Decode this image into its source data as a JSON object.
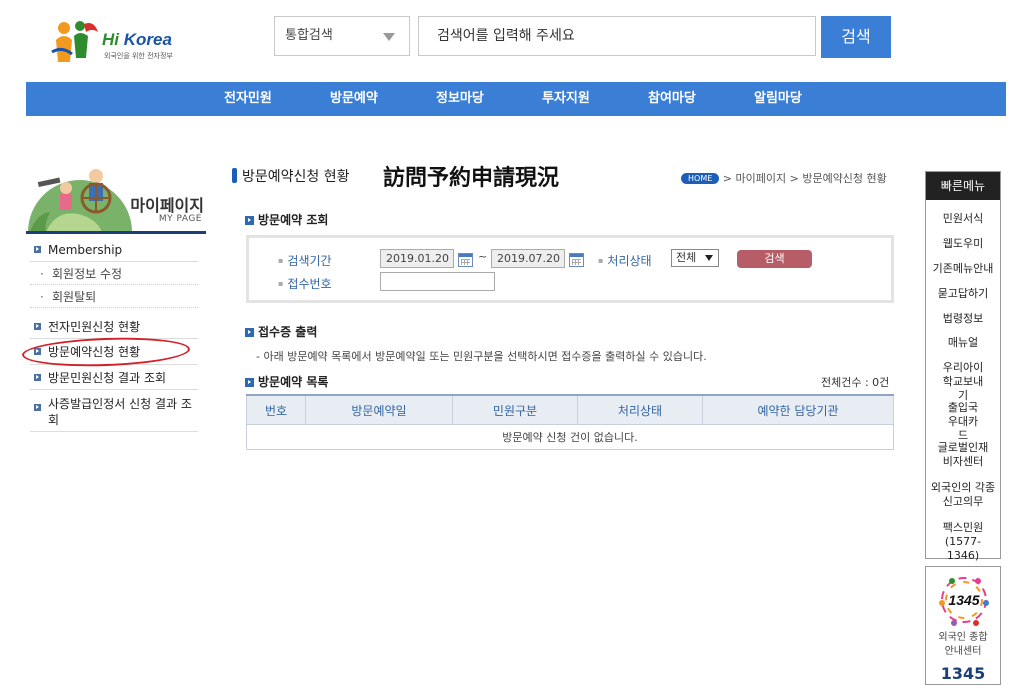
{
  "header": {
    "logo": {
      "brand_prefix": "Hi",
      "brand_name": "Korea",
      "tagline": "외국인을 위한 전자정부"
    },
    "search": {
      "scope": "통합검색",
      "placeholder": "검색어를 입력해 주세요",
      "button": "검색"
    },
    "gnb": [
      "전자민원",
      "방문예약",
      "정보마당",
      "투자지원",
      "참여마당",
      "알림마당"
    ]
  },
  "sidebar": {
    "banner_title": "마이페이지",
    "banner_subtitle": "MY PAGE",
    "items": [
      {
        "label": "Membership",
        "children": [
          "회원정보 수정",
          "회원탈퇴"
        ]
      },
      {
        "label": "전자민원신청 현황"
      },
      {
        "label": "방문예약신청 현황"
      },
      {
        "label": "방문민원신청 결과 조회"
      },
      {
        "label": "사증발급인정서 신청 결과 조회"
      }
    ]
  },
  "main": {
    "title": "방문예약신청 현황",
    "title_hanja": "訪問予約申請現況",
    "breadcrumb": {
      "home": "HOME",
      "sep": ">",
      "items": [
        "마이페이지",
        "방문예약신청 현황"
      ]
    },
    "search_section": {
      "title": "방문예약 조회",
      "period_label": "검색기간",
      "date_from": "2019.01.20",
      "date_sep": "~",
      "date_to": "2019.07.20",
      "status_label": "처리상태",
      "status_value": "전체",
      "search_button": "검색",
      "receipt_label": "접수번호"
    },
    "receipt_section": {
      "title": "접수증 출력",
      "description": "- 아래 방문예약 목록에서 방문예약일 또는 민원구분을 선택하시면 접수증을 출력하실 수 있습니다."
    },
    "list_section": {
      "title": "방문예약 목록",
      "total": "전체건수 : 0건",
      "columns": [
        "번호",
        "방문예약일",
        "민원구분",
        "처리상태",
        "예약한 담당기관"
      ],
      "empty_message": "방문예약 신청 건이 없습니다."
    }
  },
  "quick_menu": {
    "title": "빠른메뉴",
    "items": [
      "민원서식",
      "웹도우미",
      "기존메뉴안내",
      "묻고답하기",
      "법령정보",
      "매뉴얼",
      "우리아이 학교보내기",
      "출입국 우대카드",
      "글로벌인재 비자센터",
      "외국인의 각종 신고의무",
      "팩스민원 (1577-1346)"
    ]
  },
  "help_center": {
    "badge": "1345",
    "line1": "외국인 종합",
    "line2": "안내센터",
    "number": "1345"
  }
}
